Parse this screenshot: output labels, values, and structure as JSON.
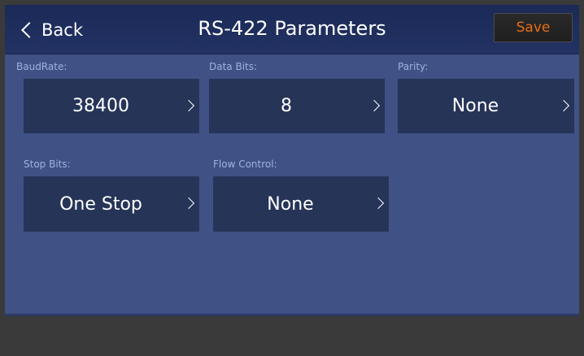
{
  "header": {
    "back_label": "Back",
    "title": "RS-422 Parameters",
    "save_label": "Save"
  },
  "fields": {
    "baud_rate": {
      "label": "BaudRate:",
      "value": "38400"
    },
    "data_bits": {
      "label": "Data Bits:",
      "value": "8"
    },
    "parity": {
      "label": "Parity:",
      "value": "None"
    },
    "stop_bits": {
      "label": "Stop Bits:",
      "value": "One Stop"
    },
    "flow_control": {
      "label": "Flow Control:",
      "value": "None"
    }
  },
  "colors": {
    "panel_bg": "#3f5185",
    "header_bg": "#1f2e5e",
    "selector_bg": "#263458",
    "save_text": "#e56e13",
    "label_text": "#9fb2dd"
  }
}
